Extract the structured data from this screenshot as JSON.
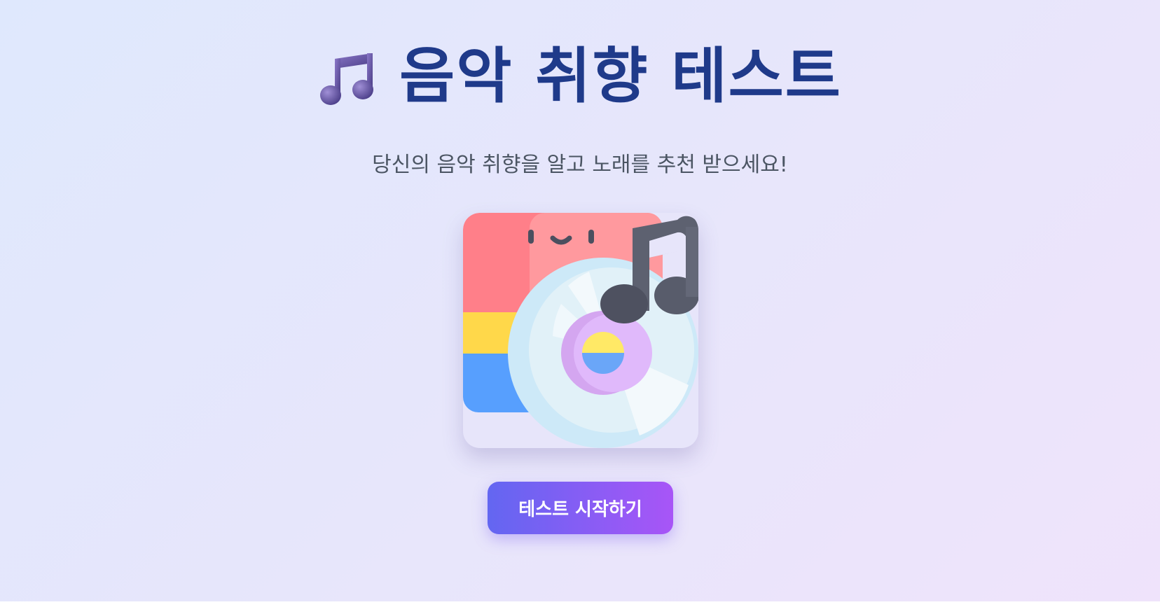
{
  "header": {
    "title": "음악 취향 테스트",
    "title_icon": "musical-notes-icon"
  },
  "intro": {
    "subtitle": "당신의 음악 취향을 알고 노래를 추천 받으세요!"
  },
  "hero": {
    "illustration": "album-cd-music-note-illustration"
  },
  "actions": {
    "start_label": "테스트 시작하기"
  },
  "colors": {
    "title": "#1f3a8a",
    "subtitle": "#4b5563",
    "button_gradient_start": "#6366f1",
    "button_gradient_end": "#a855f7",
    "button_text": "#ffffff"
  }
}
